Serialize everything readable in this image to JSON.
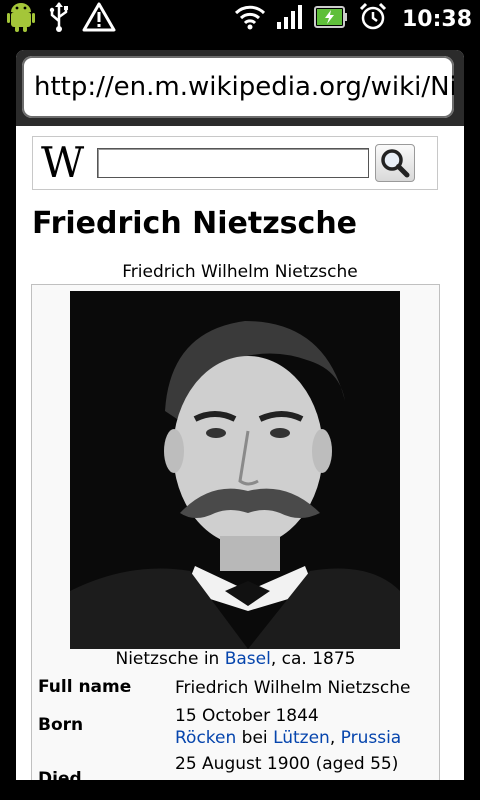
{
  "status_bar": {
    "time": "10:38",
    "icons": [
      "android-debug-icon",
      "usb-icon",
      "warning-icon",
      "wifi-icon",
      "signal-icon",
      "battery-charging-icon",
      "alarm-icon"
    ]
  },
  "browser": {
    "url": "http://en.m.wikipedia.org/wiki/Nie"
  },
  "search": {
    "logo": "W",
    "placeholder": ""
  },
  "article": {
    "title": "Friedrich Nietzsche",
    "infobox_title": "Friedrich Wilhelm Nietzsche",
    "image_caption": {
      "prefix": "Nietzsche in ",
      "link": "Basel",
      "suffix": ", ca. 1875"
    },
    "rows": [
      {
        "label": "Full name",
        "value": "Friedrich Wilhelm Nietzsche"
      },
      {
        "label": "Born",
        "date": "15 October 1844",
        "place_link1": "Röcken",
        "place_sep": " bei ",
        "place_link2": "Lützen",
        "place_comma": ", ",
        "place_link3": "Prussia"
      },
      {
        "label": "Died",
        "date": "25 August 1900 (aged 55)"
      }
    ]
  },
  "colors": {
    "link": "#0645ad",
    "statusbar": "#000000",
    "urlbar_frame": "#2b2b2b"
  }
}
